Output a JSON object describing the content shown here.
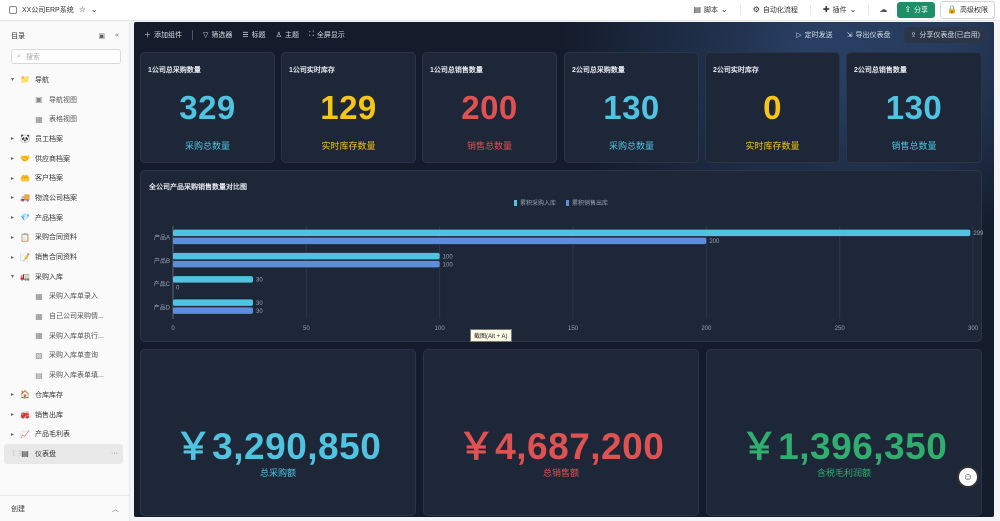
{
  "app": {
    "title": "XX公司ERP系统"
  },
  "topbar": {
    "script": "脚本",
    "automation": "自动化流程",
    "plugins": "插件",
    "share": "分享",
    "advanced_permission": "高级权限"
  },
  "sidebar": {
    "header": "目录",
    "search_placeholder": "搜索",
    "items": [
      {
        "label": "导航",
        "icon": "📁",
        "caret": "▾",
        "child": false
      },
      {
        "label": "导航视图",
        "icon": "▣",
        "child": true
      },
      {
        "label": "表格视图",
        "icon": "▦",
        "child": true
      },
      {
        "label": "员工档案",
        "icon": "🐼",
        "caret": "▸",
        "child": false
      },
      {
        "label": "供应商档案",
        "icon": "🤝",
        "caret": "▸",
        "child": false
      },
      {
        "label": "客户档案",
        "icon": "🤲",
        "caret": "▸",
        "child": false
      },
      {
        "label": "物流公司档案",
        "icon": "🚚",
        "caret": "▸",
        "child": false
      },
      {
        "label": "产品档案",
        "icon": "💎",
        "caret": "▸",
        "child": false
      },
      {
        "label": "采购合同资料",
        "icon": "📋",
        "caret": "▸",
        "child": false
      },
      {
        "label": "销售合同资料",
        "icon": "📝",
        "caret": "▸",
        "child": false
      },
      {
        "label": "采购入库",
        "icon": "🚛",
        "caret": "▾",
        "child": false
      },
      {
        "label": "采购入库单录入",
        "icon": "▦",
        "child": true
      },
      {
        "label": "自己公司采购情...",
        "icon": "▦",
        "child": true
      },
      {
        "label": "采购入库单执行...",
        "icon": "▦",
        "child": true
      },
      {
        "label": "采购入库单查询",
        "icon": "▧",
        "child": true
      },
      {
        "label": "采购入库表单填...",
        "icon": "▤",
        "child": true
      },
      {
        "label": "仓库库存",
        "icon": "🏠",
        "caret": "▸",
        "child": false
      },
      {
        "label": "销售出库",
        "icon": "🚒",
        "caret": "▸",
        "child": false
      },
      {
        "label": "产品毛利表",
        "icon": "📈",
        "caret": "▸",
        "child": false
      },
      {
        "label": "仪表盘",
        "icon": "▤",
        "caret": "⋮⋮",
        "child": false,
        "active": true
      }
    ],
    "footer": "创建"
  },
  "dashboard": {
    "toolbar": {
      "add_component": "添加组件",
      "filter": "筛选器",
      "title": "标题",
      "theme": "主题",
      "fullscreen": "全屏显示",
      "realtime": "定时发送",
      "export": "导出仪表盘",
      "share": "分享仪表盘(已启用)"
    },
    "kpis": [
      {
        "title": "1公司总采购数量",
        "value": "329",
        "label": "采购总数量",
        "color": "#4fc3e0"
      },
      {
        "title": "1公司实时库存",
        "value": "129",
        "label": "实时库存数量",
        "color": "#f5c518"
      },
      {
        "title": "1公司总销售数量",
        "value": "200",
        "label": "销售总数量",
        "color": "#e05252"
      },
      {
        "title": "2公司总采购数量",
        "value": "130",
        "label": "采购总数量",
        "color": "#4fc3e0"
      },
      {
        "title": "2公司实时库存",
        "value": "0",
        "label": "实时库存数量",
        "color": "#f5c518"
      },
      {
        "title": "2公司总销售数量",
        "value": "130",
        "label": "销售总数量",
        "color": "#4fc3e0"
      }
    ],
    "totals": [
      {
        "value": "￥3,290,850",
        "label": "总采购额",
        "color": "#4fc3e0"
      },
      {
        "value": "￥4,687,200",
        "label": "总销售额",
        "color": "#e05252"
      },
      {
        "value": "￥1,396,350",
        "label": "含税毛利润额",
        "color": "#2fae6f"
      }
    ],
    "tooltip": "截图(Alt + A)"
  },
  "chart_data": {
    "type": "bar",
    "orientation": "horizontal",
    "title": "全公司产品采购销售数量对比图",
    "categories": [
      "产品A",
      "产品B",
      "产品C",
      "产品D"
    ],
    "series": [
      {
        "name": "累积采购入库",
        "values": [
          299,
          100,
          30,
          30
        ],
        "labels": [
          "299",
          "100",
          "30",
          "30"
        ],
        "color": "#4fc3e0"
      },
      {
        "name": "累积销售出库",
        "values": [
          200,
          100,
          0,
          30
        ],
        "labels": [
          "200",
          "100",
          "0",
          "30"
        ],
        "color": "#5b8fd9"
      }
    ],
    "xlim": [
      0,
      300
    ],
    "xticks": [
      0,
      50,
      100,
      150,
      200,
      250,
      300
    ],
    "legend_position": "top-center",
    "grid": true
  }
}
